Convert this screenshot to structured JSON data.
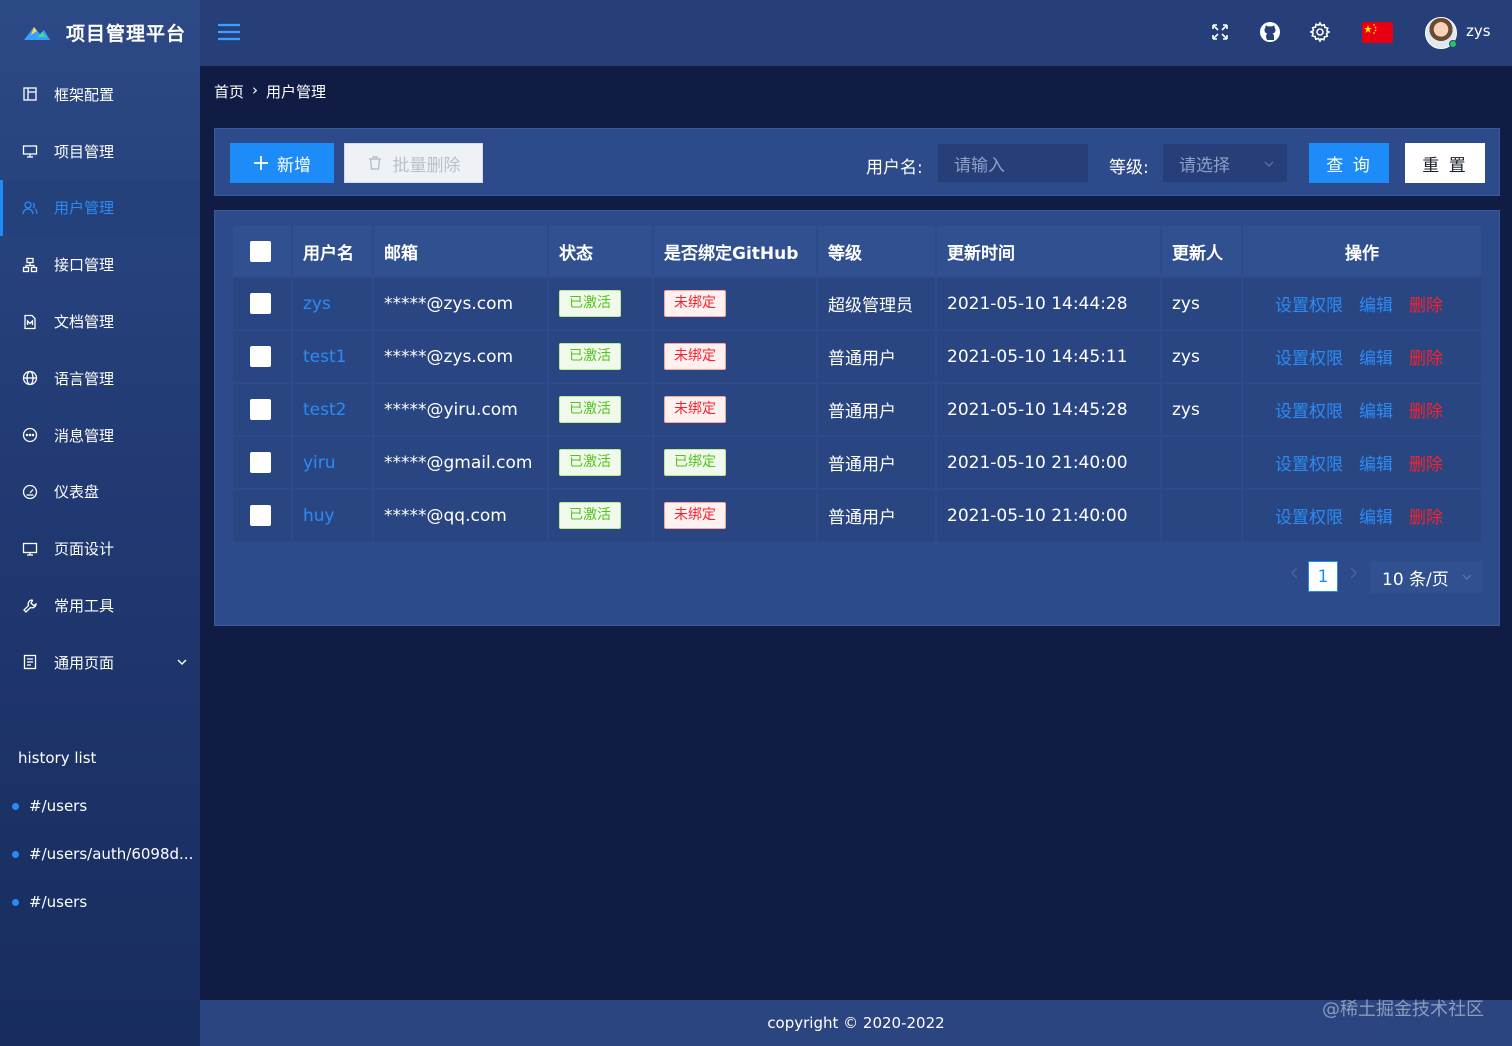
{
  "app": {
    "title": "项目管理平台"
  },
  "sidebar": {
    "items": [
      {
        "label": "框架配置",
        "icon": "layout-icon"
      },
      {
        "label": "项目管理",
        "icon": "project-icon"
      },
      {
        "label": "用户管理",
        "icon": "users-icon",
        "active": true
      },
      {
        "label": "接口管理",
        "icon": "api-icon"
      },
      {
        "label": "文档管理",
        "icon": "document-icon"
      },
      {
        "label": "语言管理",
        "icon": "globe-icon"
      },
      {
        "label": "消息管理",
        "icon": "message-icon"
      },
      {
        "label": "仪表盘",
        "icon": "dashboard-icon"
      },
      {
        "label": "页面设计",
        "icon": "monitor-icon"
      },
      {
        "label": "常用工具",
        "icon": "wrench-icon"
      },
      {
        "label": "通用页面",
        "icon": "page-icon",
        "expandable": true
      }
    ],
    "history_title": "history list",
    "history": [
      "#/users",
      "#/users/auth/6098d...",
      "#/users"
    ]
  },
  "header": {
    "username": "zys"
  },
  "breadcrumb": {
    "home": "首页",
    "separator": "›",
    "current": "用户管理"
  },
  "toolbar": {
    "add_label": "新增",
    "batch_delete_label": "批量删除",
    "username_label": "用户名:",
    "username_placeholder": "请输入",
    "level_label": "等级:",
    "level_placeholder": "请选择",
    "query_label": "查 询",
    "reset_label": "重 置"
  },
  "table": {
    "columns": [
      "用户名",
      "邮箱",
      "状态",
      "是否绑定GitHub",
      "等级",
      "更新时间",
      "更新人",
      "操作"
    ],
    "rows": [
      {
        "username": "zys",
        "email": "*****@zys.com",
        "status": "已激活",
        "github": "未绑定",
        "github_bound": false,
        "level": "超级管理员",
        "updated": "2021-05-10 14:44:28",
        "updater": "zys"
      },
      {
        "username": "test1",
        "email": "*****@zys.com",
        "status": "已激活",
        "github": "未绑定",
        "github_bound": false,
        "level": "普通用户",
        "updated": "2021-05-10 14:45:11",
        "updater": "zys"
      },
      {
        "username": "test2",
        "email": "*****@yiru.com",
        "status": "已激活",
        "github": "未绑定",
        "github_bound": false,
        "level": "普通用户",
        "updated": "2021-05-10 14:45:28",
        "updater": "zys"
      },
      {
        "username": "yiru",
        "email": "*****@gmail.com",
        "status": "已激活",
        "github": "已绑定",
        "github_bound": true,
        "level": "普通用户",
        "updated": "2021-05-10 21:40:00",
        "updater": ""
      },
      {
        "username": "huy",
        "email": "*****@qq.com",
        "status": "已激活",
        "github": "未绑定",
        "github_bound": false,
        "level": "普通用户",
        "updated": "2021-05-10 21:40:00",
        "updater": ""
      }
    ],
    "actions": {
      "permission": "设置权限",
      "edit": "编辑",
      "delete": "删除"
    }
  },
  "pagination": {
    "current_page": "1",
    "page_size": "10 条/页"
  },
  "footer": {
    "copyright": "copyright © 2020-2022"
  },
  "watermark": "@稀土掘金技术社区",
  "colors": {
    "accent": "#1d8cf8",
    "danger": "#f5222d",
    "success": "#52c41a",
    "background": "#111c45"
  }
}
